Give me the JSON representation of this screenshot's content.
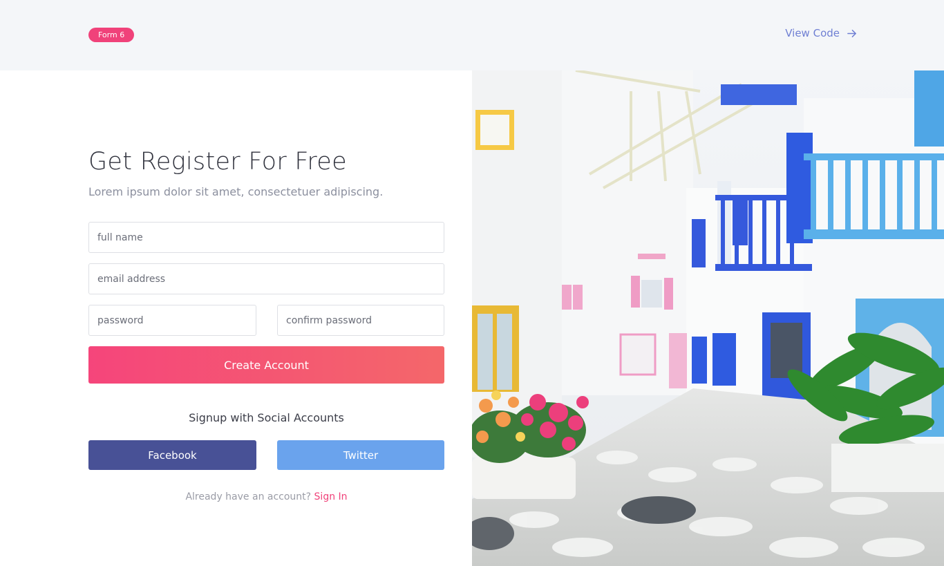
{
  "header": {
    "badge": "Form 6",
    "view_code": "View Code"
  },
  "form": {
    "title": "Get Register For Free",
    "subtitle": "Lorem ipsum dolor sit amet, consectetuer adipiscing.",
    "full_name_placeholder": "full name",
    "email_placeholder": "email address",
    "password_placeholder": "password",
    "confirm_password_placeholder": "confirm password",
    "create_button": "Create Account",
    "social_heading": "Signup with Social Accounts",
    "facebook_button": "Facebook",
    "twitter_button": "Twitter",
    "signin_prompt": "Already have an account?",
    "signin_link": "Sign In"
  },
  "colors": {
    "accent_pink": "#f0427a",
    "gradient_start": "#f5457b",
    "gradient_end": "#f4676a",
    "facebook": "#485196",
    "twitter": "#6aa3ed",
    "link_blue": "#6f7fd3"
  }
}
